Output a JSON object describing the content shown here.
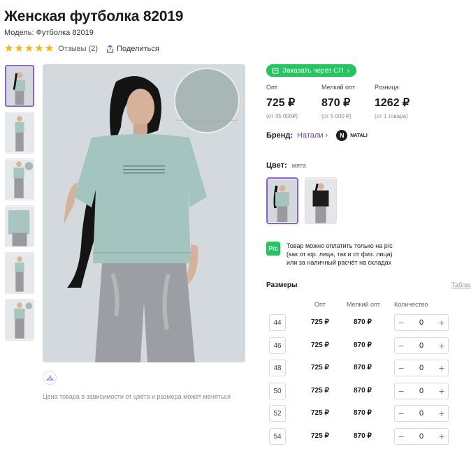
{
  "product": {
    "title": "Женская футболка 82019",
    "model": "Модель: Футболка 82019",
    "rating_stars": 5,
    "reviews": "Отзывы (2)",
    "share": "Поделиться"
  },
  "gallery": {
    "thumbnails": 6,
    "active_thumb": 0,
    "price_note": "Цена товара в зависимости от цвета и размера может меняться"
  },
  "sp_button": "Заказать через СП",
  "prices": [
    {
      "label": "Опт",
      "value": "725 ₽",
      "sub": "(от 35 000₽)"
    },
    {
      "label": "Мелкий опт",
      "value": "870 ₽",
      "sub": "(от 5 000 ₽)"
    },
    {
      "label": "Розница",
      "value": "1262 ₽",
      "sub": "(от 1 товара)"
    }
  ],
  "brand": {
    "label": "Бренд:",
    "name": "Натали",
    "logo_text": "NATALI",
    "logo_letter": "N"
  },
  "color": {
    "label": "Цвет:",
    "value": "мята"
  },
  "payment": {
    "icon": "P/c",
    "line1": "Товар можно оплатить только на р/с",
    "line2": "(как от юр. лица, так и от физ. лица)",
    "line3": "или за наличный расчёт на складах"
  },
  "sizes": {
    "title": "Размеры",
    "table_link": "Таблиц",
    "headers": {
      "opt": "Опт",
      "small": "Мелкий опт",
      "qty": "Количество"
    },
    "rows": [
      {
        "size": "44",
        "opt": "725 ₽",
        "small": "870 ₽",
        "qty": "0"
      },
      {
        "size": "46",
        "opt": "725 ₽",
        "small": "870 ₽",
        "qty": "0"
      },
      {
        "size": "48",
        "opt": "725 ₽",
        "small": "870 ₽",
        "qty": "0"
      },
      {
        "size": "50",
        "opt": "725 ₽",
        "small": "870 ₽",
        "qty": "0"
      },
      {
        "size": "52",
        "opt": "725 ₽",
        "small": "870 ₽",
        "qty": "0"
      },
      {
        "size": "54",
        "opt": "725 ₽",
        "small": "870 ₽",
        "qty": "0"
      }
    ]
  },
  "colors": {
    "accent": "#8a5cf6",
    "green": "#22c55e",
    "star": "#f5b400",
    "brand_link": "#6c3cf0"
  }
}
